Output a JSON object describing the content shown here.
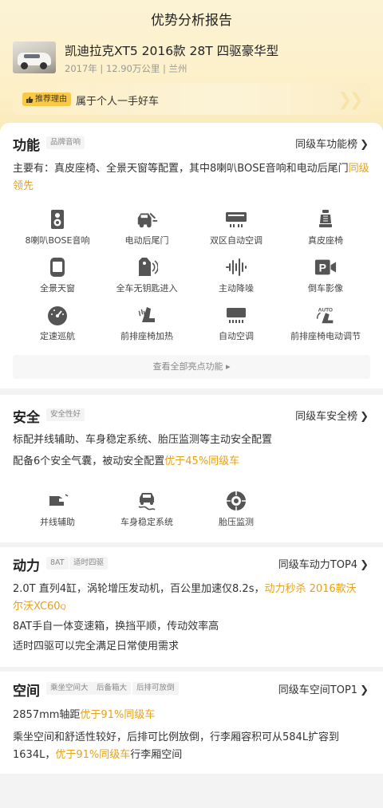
{
  "header": {
    "title": "优势分析报告",
    "car_title": "凯迪拉克XT5 2016款 28T 四驱豪华型",
    "car_sub": "2017年 | 12.90万公里 | 兰州",
    "reason_tag": "推荐理由",
    "reason_text": "属于个人一手好车"
  },
  "function": {
    "title": "功能",
    "tag": "品牌音响",
    "rank": "同级车功能榜",
    "desc_main": "主要有：真皮座椅、全景天窗等配置，其中8喇叭BOSE音响和电动后尾门",
    "desc_highlight": "同级领先",
    "items": [
      {
        "label": "8喇叭BOSE音响",
        "icon": "speaker-icon"
      },
      {
        "label": "电动后尾门",
        "icon": "tailgate-icon"
      },
      {
        "label": "双区自动空调",
        "icon": "dual-ac-icon"
      },
      {
        "label": "真皮座椅",
        "icon": "leather-seat-icon"
      },
      {
        "label": "全景天窗",
        "icon": "sunroof-icon"
      },
      {
        "label": "全车无钥匙进入",
        "icon": "keyless-icon"
      },
      {
        "label": "主动降噪",
        "icon": "noise-cancel-icon"
      },
      {
        "label": "倒车影像",
        "icon": "parking-camera-icon"
      },
      {
        "label": "定速巡航",
        "icon": "cruise-icon"
      },
      {
        "label": "前排座椅加热",
        "icon": "seat-heat-icon"
      },
      {
        "label": "自动空调",
        "icon": "auto-ac-icon"
      },
      {
        "label": "前排座椅电动调节",
        "icon": "seat-adjust-icon"
      }
    ],
    "view_all": "查看全部亮点功能 ▸"
  },
  "safety": {
    "title": "安全",
    "tag": "安全性好",
    "rank": "同级车安全榜",
    "line1": "标配并线辅助、车身稳定系统、胎压监测等主动安全配置",
    "line2_a": "配备6个安全气囊，被动安全配置",
    "line2_hl": "优于45%同级车",
    "items": [
      {
        "label": "并线辅助",
        "icon": "lane-assist-icon"
      },
      {
        "label": "车身稳定系统",
        "icon": "stability-icon"
      },
      {
        "label": "胎压监测",
        "icon": "tire-pressure-icon"
      }
    ]
  },
  "power": {
    "title": "动力",
    "tags": [
      "8AT",
      "适时四驱"
    ],
    "rank": "同级车动力TOP4",
    "line1_a": "2.0T 直列4缸，涡轮增压发动机，百公里加速仅8.2s，",
    "line1_hl1": "动力秒杀 2016款沃",
    "line1_hl2": "尔沃XC60",
    "line2": "8AT手自一体变速箱，换挡平顺，传动效率高",
    "line3": "适时四驱可以完全满足日常使用需求"
  },
  "space": {
    "title": "空间",
    "tags": [
      "乘坐空间大",
      "后备箱大",
      "后排可放倒"
    ],
    "rank": "同级车空间TOP1",
    "line1_a": "2857mm轴距",
    "line1_hl": "优于91%同级车",
    "line2": "乘坐空间和舒适性较好，后排可比例放倒，行李厢容积可从584L扩容到",
    "line3_a": "1634L，",
    "line3_hl": "优于91%同级车",
    "line3_b": "行李厢空间"
  },
  "colors": {
    "accent": "#e5a21c",
    "tag_yellow": "#f7c945",
    "icon": "#555555"
  }
}
